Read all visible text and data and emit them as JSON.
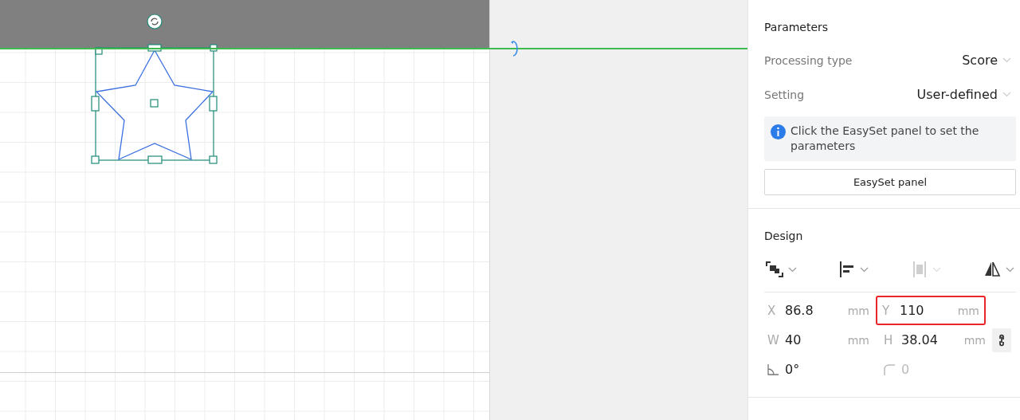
{
  "parameters": {
    "title": "Parameters",
    "rows": [
      {
        "label": "Processing type",
        "value": "Score"
      },
      {
        "label": "Setting",
        "value": "User-defined"
      }
    ],
    "info": "Click the EasySet panel to set the parameters",
    "button": "EasySet panel"
  },
  "design": {
    "title": "Design",
    "tools": [
      {
        "kind": "arrange",
        "disabled": false
      },
      {
        "kind": "align",
        "disabled": false
      },
      {
        "kind": "distribute",
        "disabled": true
      },
      {
        "kind": "flip",
        "disabled": false
      }
    ],
    "fields": [
      {
        "kind": "measure",
        "label": "X",
        "value": "86.8",
        "unit": "mm",
        "highlighted": false
      },
      {
        "kind": "measure",
        "label": "Y",
        "value": "110",
        "unit": "mm",
        "highlighted": true
      },
      {
        "kind": "measure",
        "label": "W",
        "value": "40",
        "unit": "mm",
        "highlighted": false
      },
      {
        "kind": "measure",
        "label": "H",
        "value": "38.04",
        "unit": "mm",
        "highlighted": false
      },
      {
        "kind": "angle",
        "value": "0°",
        "disabled": false
      },
      {
        "kind": "corner",
        "value": "0",
        "disabled": true
      }
    ]
  }
}
